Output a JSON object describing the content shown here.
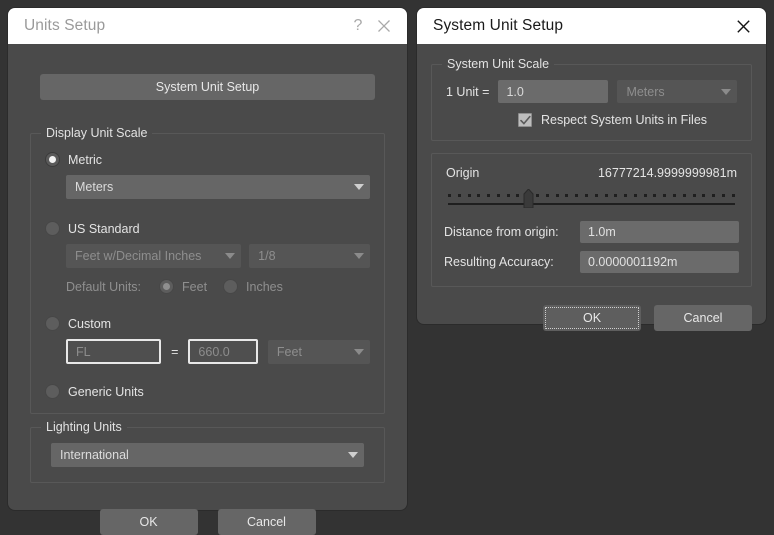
{
  "units_setup": {
    "title": "Units Setup",
    "help_icon": "question-mark-icon",
    "close_icon": "close-icon",
    "system_unit_setup_button": "System Unit Setup",
    "display_unit_scale": {
      "label": "Display Unit Scale",
      "metric": {
        "label": "Metric",
        "selected": true,
        "unit": "Meters"
      },
      "us_standard": {
        "label": "US Standard",
        "selected": false,
        "format": "Feet w/Decimal Inches",
        "fraction": "1/8",
        "default_units_label": "Default Units:",
        "default_feet": "Feet",
        "default_inches": "Inches",
        "default_selected": "Feet"
      },
      "custom": {
        "label": "Custom",
        "selected": false,
        "name_value": "FL",
        "equals": "=",
        "scale_value": "660.0",
        "unit": "Feet"
      },
      "generic_units": {
        "label": "Generic Units",
        "selected": false
      }
    },
    "lighting_units": {
      "label": "Lighting Units",
      "value": "International"
    },
    "ok_label": "OK",
    "cancel_label": "Cancel"
  },
  "system_unit_setup": {
    "title": "System Unit Setup",
    "close_icon": "close-icon",
    "system_unit_scale": {
      "label": "System Unit Scale",
      "one_unit_label": "1 Unit =",
      "one_unit_value": "1.0",
      "unit": "Meters",
      "respect_label": "Respect System Units in Files",
      "respect_checked": true,
      "check_icon": "checkmark-icon"
    },
    "origin": {
      "label": "Origin",
      "value": "16777214.9999999981m",
      "slider_position_percent": 28,
      "slider_tick_count": 30,
      "distance_label": "Distance from origin:",
      "distance_value": "1.0m",
      "accuracy_label": "Resulting Accuracy:",
      "accuracy_value": "0.0000001192m"
    },
    "ok_label": "OK",
    "cancel_label": "Cancel"
  },
  "colors": {
    "desktop": "#333333",
    "dialog": "#4a4a4a",
    "titlebar": "#ffffff",
    "button": "#666666",
    "field": "#6b6b6b",
    "text": "#e4e4e4",
    "text_dim": "#8f8f8f"
  }
}
